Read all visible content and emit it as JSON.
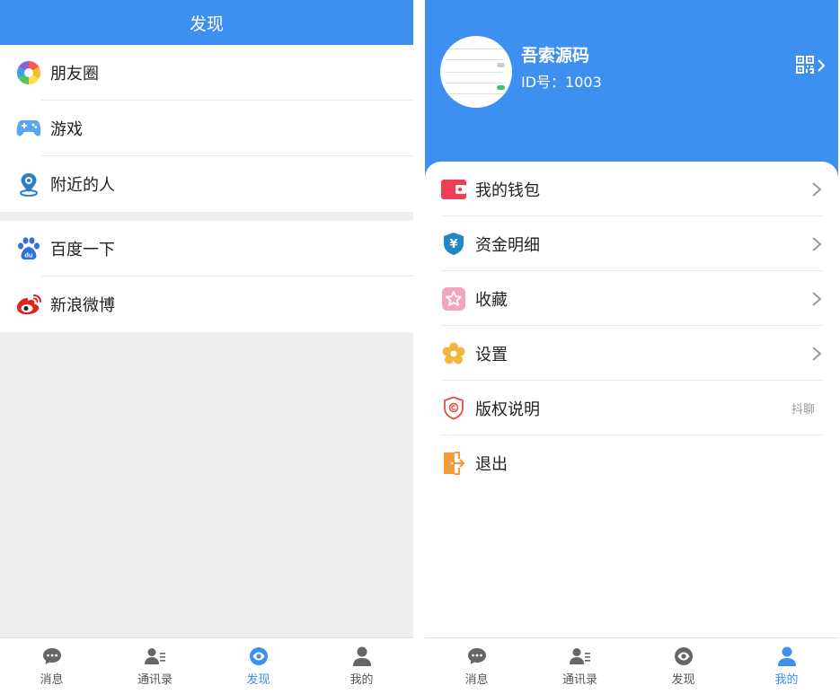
{
  "colors": {
    "primary": "#3d8ff0",
    "tab_inactive": "#555555",
    "background": "#efefef"
  },
  "discover": {
    "title": "发现",
    "groups": [
      [
        {
          "icon": "moments-icon",
          "label": "朋友圈"
        },
        {
          "icon": "gamepad-icon",
          "label": "游戏"
        },
        {
          "icon": "location-pin-icon",
          "label": "附近的人"
        }
      ],
      [
        {
          "icon": "baidu-icon",
          "label": "百度一下"
        },
        {
          "icon": "weibo-icon",
          "label": "新浪微博"
        }
      ]
    ]
  },
  "me": {
    "nickname": "吾索源码",
    "id_text": "ID号：1003",
    "menu": [
      {
        "icon": "wallet-icon",
        "label": "我的钱包",
        "arrow": true
      },
      {
        "icon": "yuan-shield-icon",
        "label": "资金明细",
        "arrow": true
      },
      {
        "icon": "favorite-star-icon",
        "label": "收藏",
        "arrow": true
      },
      {
        "icon": "settings-gear-icon",
        "label": "设置",
        "arrow": true
      },
      {
        "icon": "copyright-shield-icon",
        "label": "版权说明",
        "arrow": false,
        "extra": "抖聊"
      },
      {
        "icon": "logout-door-icon",
        "label": "退出",
        "arrow": false
      }
    ]
  },
  "tabs": [
    {
      "icon": "chat-bubble-icon",
      "label": "消息"
    },
    {
      "icon": "contacts-icon",
      "label": "通讯录"
    },
    {
      "icon": "eye-icon",
      "label": "发现"
    },
    {
      "icon": "person-icon",
      "label": "我的"
    }
  ],
  "left_active_tab": "发现",
  "right_active_tab": "我的"
}
